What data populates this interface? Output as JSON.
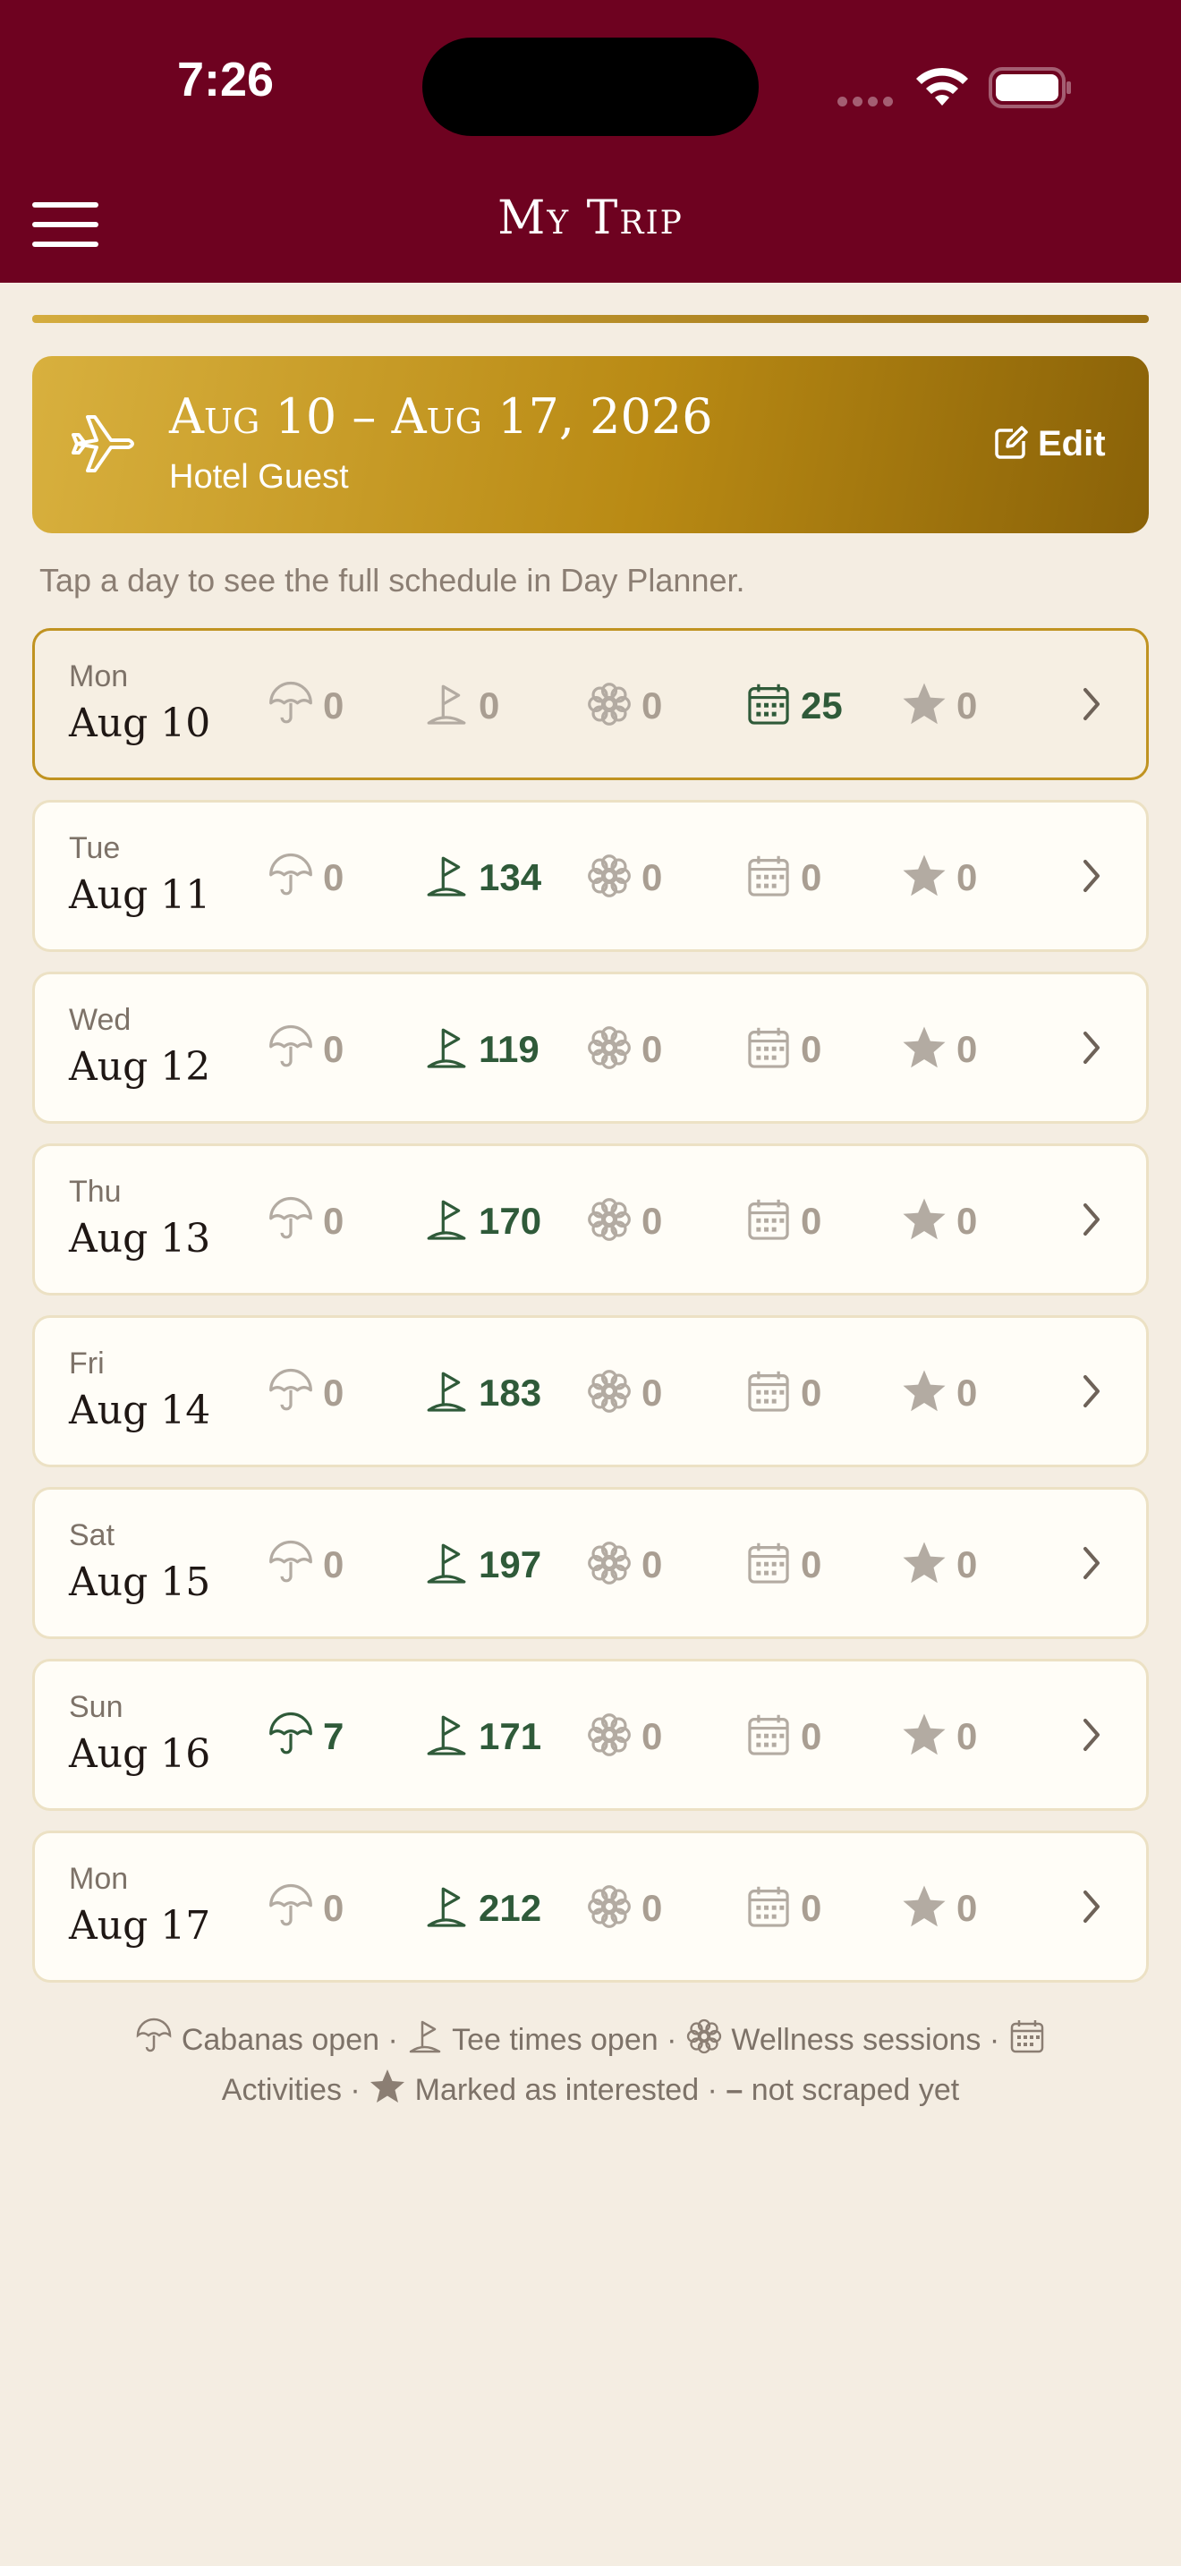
{
  "status": {
    "time": "7:26"
  },
  "nav": {
    "title": "My Trip"
  },
  "trip": {
    "dates": "Aug 10 – Aug 17, 2026",
    "subtitle": "Hotel Guest",
    "edit_label": "Edit"
  },
  "hint": "Tap a day to see the full schedule in Day Planner.",
  "days": [
    {
      "dow": "Mon",
      "date": "Aug 10",
      "cabanas": "0",
      "tee": "0",
      "wellness": "0",
      "activities": "25",
      "interested": "0"
    },
    {
      "dow": "Tue",
      "date": "Aug 11",
      "cabanas": "0",
      "tee": "134",
      "wellness": "0",
      "activities": "0",
      "interested": "0"
    },
    {
      "dow": "Wed",
      "date": "Aug 12",
      "cabanas": "0",
      "tee": "119",
      "wellness": "0",
      "activities": "0",
      "interested": "0"
    },
    {
      "dow": "Thu",
      "date": "Aug 13",
      "cabanas": "0",
      "tee": "170",
      "wellness": "0",
      "activities": "0",
      "interested": "0"
    },
    {
      "dow": "Fri",
      "date": "Aug 14",
      "cabanas": "0",
      "tee": "183",
      "wellness": "0",
      "activities": "0",
      "interested": "0"
    },
    {
      "dow": "Sat",
      "date": "Aug 15",
      "cabanas": "0",
      "tee": "197",
      "wellness": "0",
      "activities": "0",
      "interested": "0"
    },
    {
      "dow": "Sun",
      "date": "Aug 16",
      "cabanas": "7",
      "tee": "171",
      "wellness": "0",
      "activities": "0",
      "interested": "0"
    },
    {
      "dow": "Mon",
      "date": "Aug 17",
      "cabanas": "0",
      "tee": "212",
      "wellness": "0",
      "activities": "0",
      "interested": "0"
    }
  ],
  "legend": {
    "cabanas": "Cabanas open ·",
    "tee": "Tee times open ·",
    "wellness": "Wellness sessions ·",
    "activities": "Activities ·",
    "interested": "Marked as interested ·",
    "dash": "–",
    "not_scraped": "not scraped yet"
  },
  "colors": {
    "header": "#6e0220",
    "gold": "#c09321",
    "active_green": "#2f5a39",
    "muted": "#a99e92",
    "background": "#f4ede2"
  },
  "icons": [
    "umbrella-icon",
    "golf-flag-icon",
    "flower-icon",
    "calendar-icon",
    "star-icon",
    "chevron-right-icon",
    "airplane-icon",
    "edit-icon",
    "menu-icon"
  ]
}
